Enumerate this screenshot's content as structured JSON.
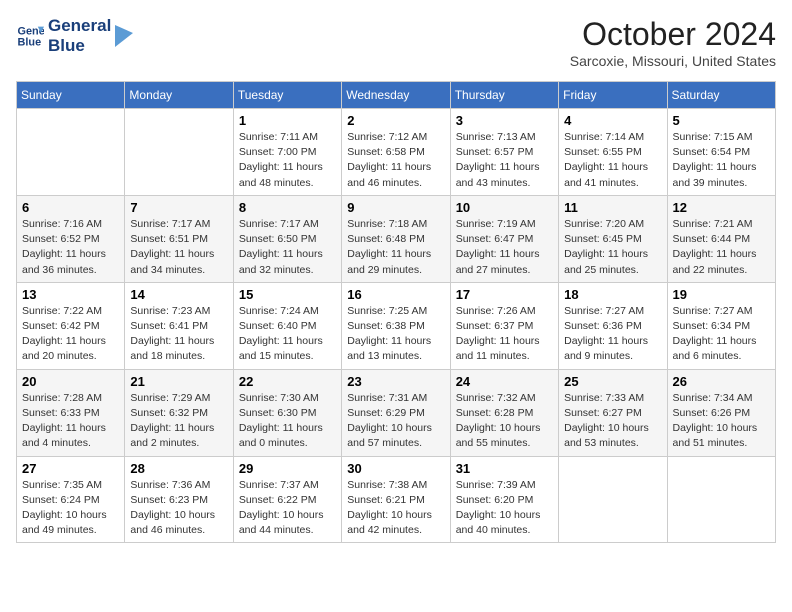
{
  "header": {
    "logo_line1": "General",
    "logo_line2": "Blue",
    "month": "October 2024",
    "location": "Sarcoxie, Missouri, United States"
  },
  "weekdays": [
    "Sunday",
    "Monday",
    "Tuesday",
    "Wednesday",
    "Thursday",
    "Friday",
    "Saturday"
  ],
  "weeks": [
    [
      {
        "day": null
      },
      {
        "day": null
      },
      {
        "day": "1",
        "sunrise": "7:11 AM",
        "sunset": "7:00 PM",
        "daylight": "11 hours and 48 minutes."
      },
      {
        "day": "2",
        "sunrise": "7:12 AM",
        "sunset": "6:58 PM",
        "daylight": "11 hours and 46 minutes."
      },
      {
        "day": "3",
        "sunrise": "7:13 AM",
        "sunset": "6:57 PM",
        "daylight": "11 hours and 43 minutes."
      },
      {
        "day": "4",
        "sunrise": "7:14 AM",
        "sunset": "6:55 PM",
        "daylight": "11 hours and 41 minutes."
      },
      {
        "day": "5",
        "sunrise": "7:15 AM",
        "sunset": "6:54 PM",
        "daylight": "11 hours and 39 minutes."
      }
    ],
    [
      {
        "day": "6",
        "sunrise": "7:16 AM",
        "sunset": "6:52 PM",
        "daylight": "11 hours and 36 minutes."
      },
      {
        "day": "7",
        "sunrise": "7:17 AM",
        "sunset": "6:51 PM",
        "daylight": "11 hours and 34 minutes."
      },
      {
        "day": "8",
        "sunrise": "7:17 AM",
        "sunset": "6:50 PM",
        "daylight": "11 hours and 32 minutes."
      },
      {
        "day": "9",
        "sunrise": "7:18 AM",
        "sunset": "6:48 PM",
        "daylight": "11 hours and 29 minutes."
      },
      {
        "day": "10",
        "sunrise": "7:19 AM",
        "sunset": "6:47 PM",
        "daylight": "11 hours and 27 minutes."
      },
      {
        "day": "11",
        "sunrise": "7:20 AM",
        "sunset": "6:45 PM",
        "daylight": "11 hours and 25 minutes."
      },
      {
        "day": "12",
        "sunrise": "7:21 AM",
        "sunset": "6:44 PM",
        "daylight": "11 hours and 22 minutes."
      }
    ],
    [
      {
        "day": "13",
        "sunrise": "7:22 AM",
        "sunset": "6:42 PM",
        "daylight": "11 hours and 20 minutes."
      },
      {
        "day": "14",
        "sunrise": "7:23 AM",
        "sunset": "6:41 PM",
        "daylight": "11 hours and 18 minutes."
      },
      {
        "day": "15",
        "sunrise": "7:24 AM",
        "sunset": "6:40 PM",
        "daylight": "11 hours and 15 minutes."
      },
      {
        "day": "16",
        "sunrise": "7:25 AM",
        "sunset": "6:38 PM",
        "daylight": "11 hours and 13 minutes."
      },
      {
        "day": "17",
        "sunrise": "7:26 AM",
        "sunset": "6:37 PM",
        "daylight": "11 hours and 11 minutes."
      },
      {
        "day": "18",
        "sunrise": "7:27 AM",
        "sunset": "6:36 PM",
        "daylight": "11 hours and 9 minutes."
      },
      {
        "day": "19",
        "sunrise": "7:27 AM",
        "sunset": "6:34 PM",
        "daylight": "11 hours and 6 minutes."
      }
    ],
    [
      {
        "day": "20",
        "sunrise": "7:28 AM",
        "sunset": "6:33 PM",
        "daylight": "11 hours and 4 minutes."
      },
      {
        "day": "21",
        "sunrise": "7:29 AM",
        "sunset": "6:32 PM",
        "daylight": "11 hours and 2 minutes."
      },
      {
        "day": "22",
        "sunrise": "7:30 AM",
        "sunset": "6:30 PM",
        "daylight": "11 hours and 0 minutes."
      },
      {
        "day": "23",
        "sunrise": "7:31 AM",
        "sunset": "6:29 PM",
        "daylight": "10 hours and 57 minutes."
      },
      {
        "day": "24",
        "sunrise": "7:32 AM",
        "sunset": "6:28 PM",
        "daylight": "10 hours and 55 minutes."
      },
      {
        "day": "25",
        "sunrise": "7:33 AM",
        "sunset": "6:27 PM",
        "daylight": "10 hours and 53 minutes."
      },
      {
        "day": "26",
        "sunrise": "7:34 AM",
        "sunset": "6:26 PM",
        "daylight": "10 hours and 51 minutes."
      }
    ],
    [
      {
        "day": "27",
        "sunrise": "7:35 AM",
        "sunset": "6:24 PM",
        "daylight": "10 hours and 49 minutes."
      },
      {
        "day": "28",
        "sunrise": "7:36 AM",
        "sunset": "6:23 PM",
        "daylight": "10 hours and 46 minutes."
      },
      {
        "day": "29",
        "sunrise": "7:37 AM",
        "sunset": "6:22 PM",
        "daylight": "10 hours and 44 minutes."
      },
      {
        "day": "30",
        "sunrise": "7:38 AM",
        "sunset": "6:21 PM",
        "daylight": "10 hours and 42 minutes."
      },
      {
        "day": "31",
        "sunrise": "7:39 AM",
        "sunset": "6:20 PM",
        "daylight": "10 hours and 40 minutes."
      },
      {
        "day": null
      },
      {
        "day": null
      }
    ]
  ],
  "labels": {
    "sunrise": "Sunrise:",
    "sunset": "Sunset:",
    "daylight": "Daylight:"
  }
}
